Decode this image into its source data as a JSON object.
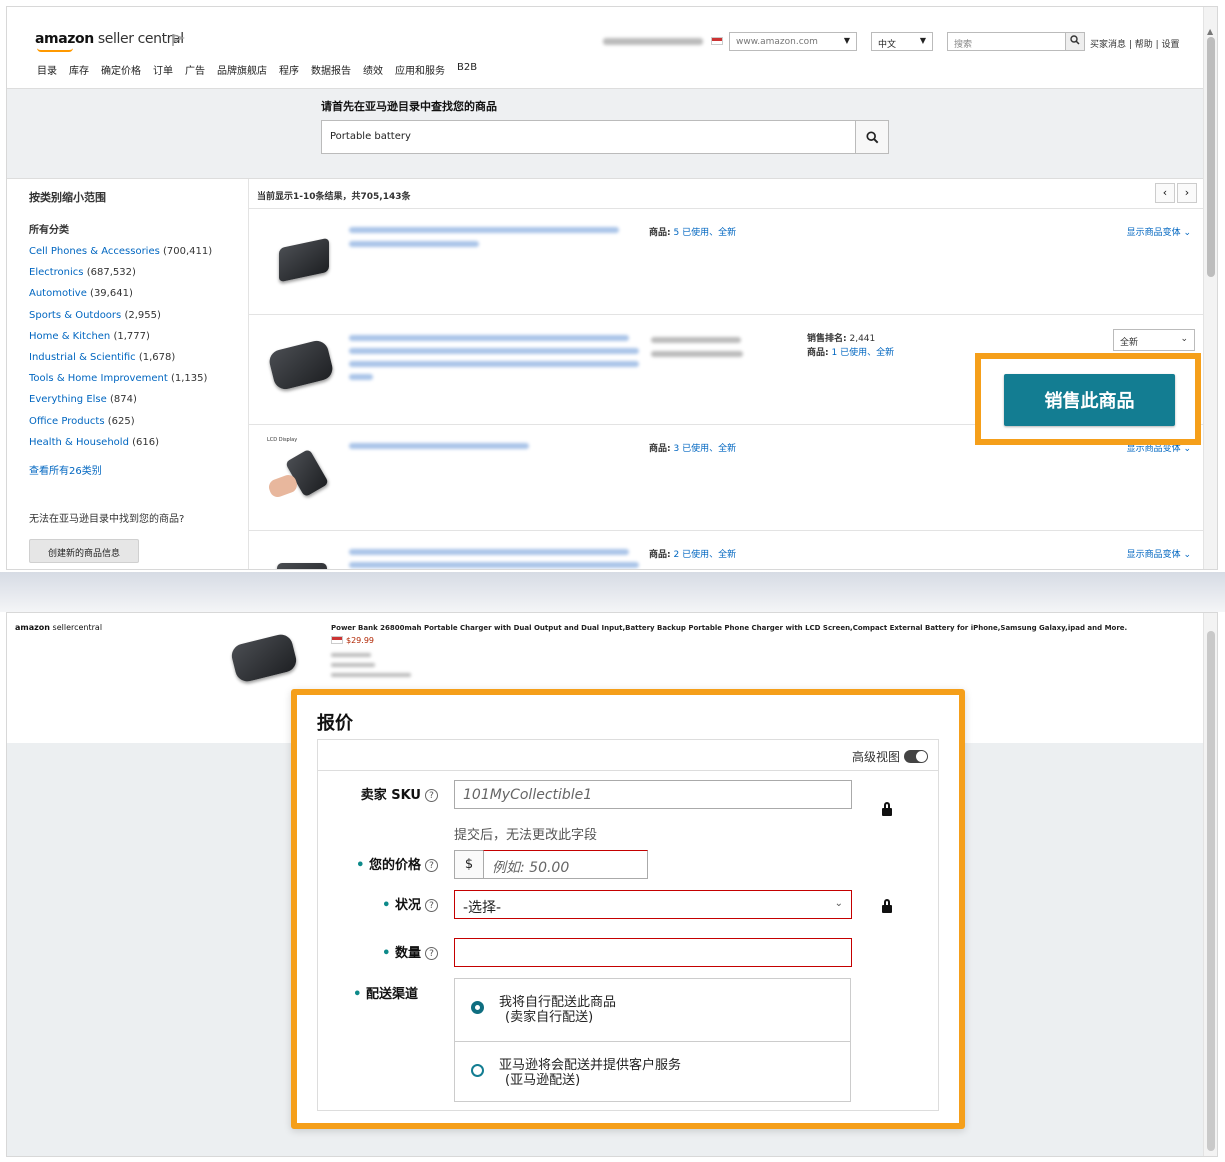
{
  "header": {
    "logo_brand": "amazon",
    "logo_product": "seller central",
    "marketplace_select": "www.amazon.com",
    "language_select": "中文",
    "search_placeholder": "搜索",
    "top_links": "买家消息 | 帮助 | 设置",
    "nav": [
      "目录",
      "库存",
      "确定价格",
      "订单",
      "广告",
      "品牌旗舰店",
      "程序",
      "数据报告",
      "绩效",
      "应用和服务",
      "B2B"
    ]
  },
  "search": {
    "title": "请首先在亚马逊目录中查找您的商品",
    "value": "Portable battery"
  },
  "sidebar": {
    "heading": "按类别缩小范围",
    "all_label": "所有分类",
    "categories": [
      {
        "name": "Cell Phones & Accessories",
        "count": "(700,411)"
      },
      {
        "name": "Electronics",
        "count": "(687,532)"
      },
      {
        "name": "Automotive",
        "count": "(39,641)"
      },
      {
        "name": "Sports & Outdoors",
        "count": "(2,955)"
      },
      {
        "name": "Home & Kitchen",
        "count": "(1,777)"
      },
      {
        "name": "Industrial & Scientific",
        "count": "(1,678)"
      },
      {
        "name": "Tools & Home Improvement",
        "count": "(1,135)"
      },
      {
        "name": "Everything Else",
        "count": "(874)"
      },
      {
        "name": "Office Products",
        "count": "(625)"
      },
      {
        "name": "Health & Household",
        "count": "(616)"
      }
    ],
    "see_all": "查看所有26类别",
    "not_found": "无法在亚马逊目录中找到您的商品?",
    "create_button": "创建新的商品信息"
  },
  "results": {
    "summary": "当前显示1-10条结果，共705,143条",
    "prev": "‹",
    "next": "›",
    "rows": [
      {
        "meta_label": "商品:",
        "meta_value": "5 已使用、全新",
        "variants": "显示商品变体 ⌄"
      },
      {
        "rank_label": "销售排名:",
        "rank_value": "2,441",
        "meta_label": "商品:",
        "meta_value": "1 已使用、全新",
        "condition": "全新"
      },
      {
        "meta_label": "商品:",
        "meta_value": "3 已使用、全新",
        "variants": "显示商品变体 ⌄",
        "image_caption": "LCD Display"
      },
      {
        "meta_label": "商品:",
        "meta_value": "2 已使用、全新",
        "variants": "显示商品变体 ⌄"
      }
    ],
    "sell_button": "销售此商品"
  },
  "detail": {
    "logo_brand": "amazon",
    "logo_product": "sellercentral",
    "product_title": "Power Bank 26800mah Portable Charger with Dual Output and Dual Input,Battery Backup Portable Phone Charger with LCD Screen,Compact External Battery for iPhone,Samsung Galaxy,ipad and More.",
    "price": "$29.99"
  },
  "offer": {
    "heading": "报价",
    "advanced_view": "高级视图",
    "sku_label": "卖家 SKU",
    "sku_placeholder": "101MyCollectible1",
    "sku_hint": "提交后，无法更改此字段",
    "price_label": "您的价格",
    "currency": "$",
    "price_placeholder": "例如:  50.00",
    "condition_label": "状况",
    "condition_value": "-选择-",
    "quantity_label": "数量",
    "channel_label": "配送渠道",
    "channel_options": [
      {
        "line1": "我将自行配送此商品",
        "line2": "(卖家自行配送)"
      },
      {
        "line1": "亚马逊将会配送并提供客户服务",
        "line2": "(亚马逊配送)"
      }
    ],
    "accent_color": "#f59f1a",
    "button_color": "#137d92"
  }
}
